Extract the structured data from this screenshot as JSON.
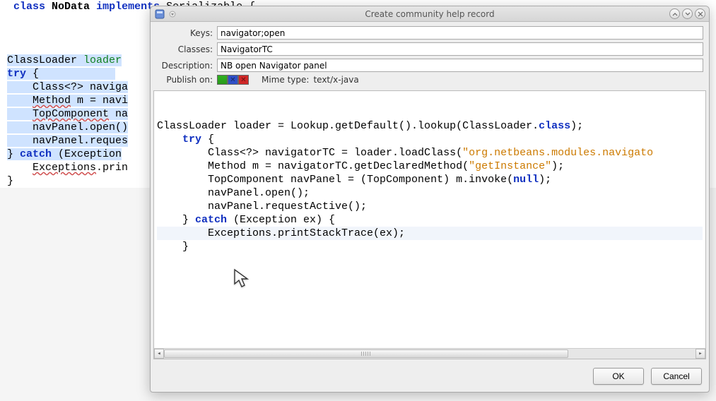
{
  "dialog": {
    "title": "Create community help record",
    "fields": {
      "keys_label": "Keys:",
      "keys_value": "navigator;open",
      "classes_label": "Classes:",
      "classes_value": "NavigatorTC",
      "description_label": "Description:",
      "description_value": "NB open Navigator panel",
      "publish_label": "Publish on:",
      "mime_label": "Mime type:",
      "mime_value": "text/x-java"
    },
    "buttons": {
      "ok": "OK",
      "cancel": "Cancel"
    },
    "code_lines": [
      {
        "cls": "",
        "html": "ClassLoader loader = Lookup.getDefault().lookup(ClassLoader.<span class='kw2'>class</span>);"
      },
      {
        "cls": "",
        "html": "    <span class='kw2'>try</span> {"
      },
      {
        "cls": "",
        "html": "        Class&lt;?&gt; navigatorTC = loader.loadClass(<span class='str'>\"org.netbeans.modules.navigato</span>"
      },
      {
        "cls": "",
        "html": "        Method m = navigatorTC.getDeclaredMethod(<span class='str'>\"getInstance\"</span>);"
      },
      {
        "cls": "",
        "html": "        TopComponent navPanel = (TopComponent) m.invoke(<span class='kw2'>null</span>);"
      },
      {
        "cls": "",
        "html": "        navPanel.open();"
      },
      {
        "cls": "",
        "html": "        navPanel.requestActive();"
      },
      {
        "cls": "",
        "html": "    } <span class='kw2'>catch</span> (Exception ex) {"
      },
      {
        "cls": "hl",
        "html": "        Exceptions.printStackTrace(ex);"
      },
      {
        "cls": "",
        "html": "    }"
      }
    ]
  },
  "bg_code": [
    " <span class='kw'>class</span> <b>NoData</b> <span class='kw'>implements</span> Serializable {",
    "",
    "",
    "",
    "<span class='bg-sel'>ClassLoader <span class='cl'>loader</span></span>",
    "<span class='bg-sel'><span class='kw'>try</span> {            </span>",
    "<span class='bg-sel'>    Class&lt;?&gt; naviga</span>",
    "<span class='bg-sel'>    <span class='und'>Method</span> m = navi</span>",
    "<span class='bg-sel'>    <span class='und'>TopComponent</span> na</span>",
    "<span class='bg-sel'>    navPanel.open()</span>",
    "<span class='bg-sel'>    navPanel.reques</span>",
    "<span class='bg-sel'>} <span class='kw'>catch</span> (Exception</span>",
    "    <span class='und'>Exceptions</span>.prin",
    "}"
  ]
}
